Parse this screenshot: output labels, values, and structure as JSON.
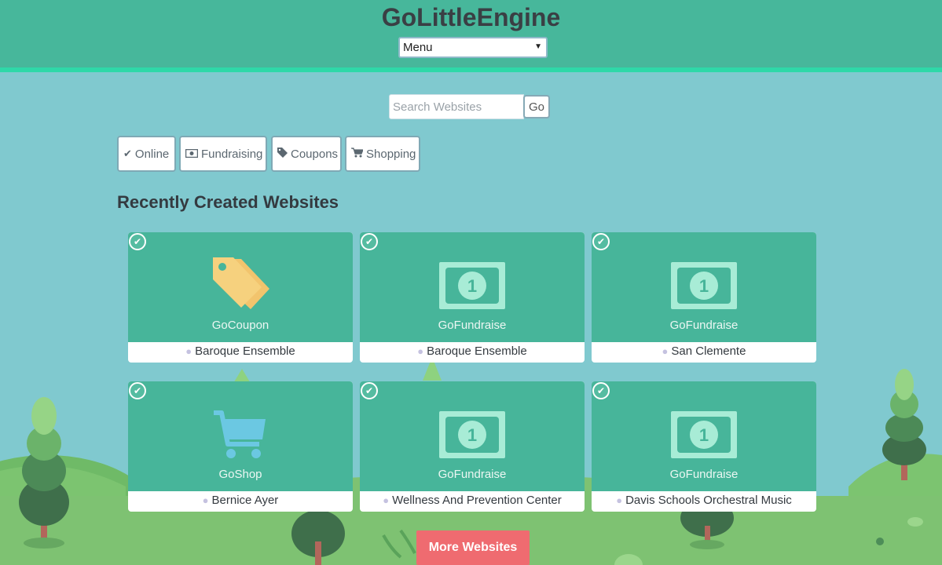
{
  "header": {
    "title": "GoLittleEngine",
    "menu_value": "Menu"
  },
  "search": {
    "placeholder": "Search Websites",
    "go_label": "Go"
  },
  "filters": [
    {
      "label": "Online",
      "icon": "check-icon"
    },
    {
      "label": "Fundraising",
      "icon": "money-icon"
    },
    {
      "label": "Coupons",
      "icon": "tag-icon"
    },
    {
      "label": "Shopping",
      "icon": "cart-icon"
    }
  ],
  "section_title": "Recently Created Websites",
  "cards": [
    {
      "type": "GoCoupon",
      "owner": "Baroque Ensemble",
      "icon": "coupon-tag-icon"
    },
    {
      "type": "GoFundraise",
      "owner": "Baroque Ensemble",
      "icon": "dollar-bill-icon"
    },
    {
      "type": "GoFundraise",
      "owner": "San Clemente",
      "icon": "dollar-bill-icon"
    },
    {
      "type": "GoShop",
      "owner": "Bernice Ayer",
      "icon": "shopping-cart-icon"
    },
    {
      "type": "GoFundraise",
      "owner": "Wellness And Prevention Center",
      "icon": "dollar-bill-icon"
    },
    {
      "type": "GoFundraise",
      "owner": "Davis Schools Orchestral Music",
      "icon": "dollar-bill-icon"
    }
  ],
  "more_button": "More Websites",
  "colors": {
    "header": "#47b79b",
    "header_border": "#2ed8a8",
    "background": "#80c9cf",
    "card": "#47b59a",
    "accent_button": "#ef6b70"
  }
}
